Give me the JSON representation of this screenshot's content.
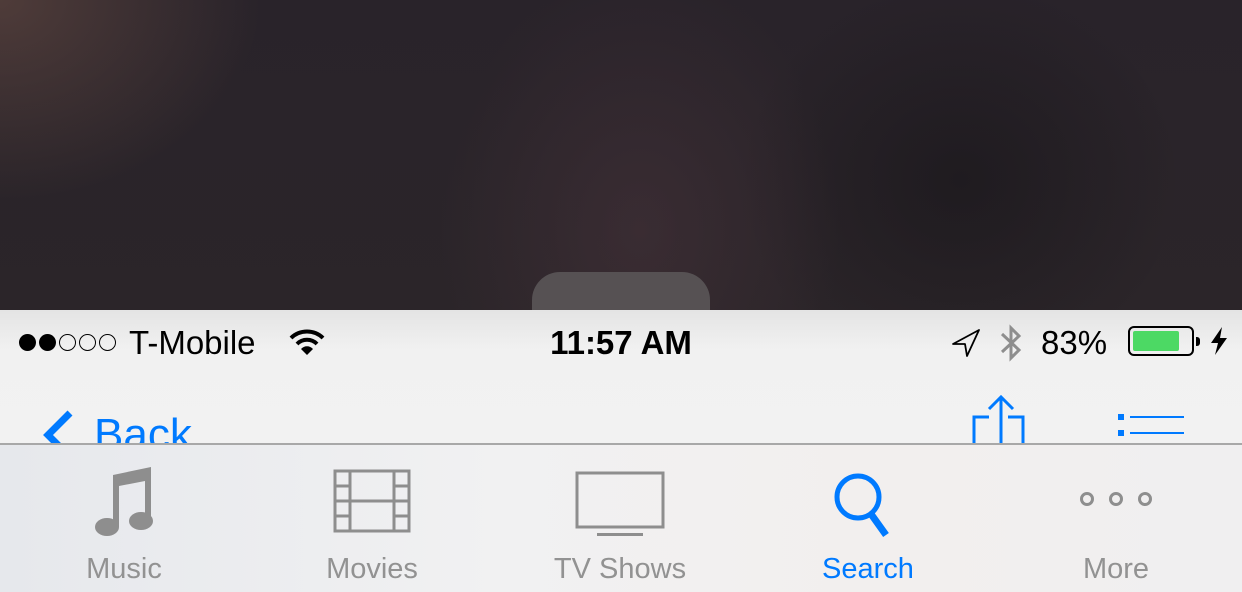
{
  "status_bar": {
    "signal_bars_filled": 2,
    "signal_bars_total": 5,
    "carrier": "T-Mobile",
    "wifi_icon": "wifi-icon",
    "time": "11:57 AM",
    "location_icon": "location-arrow-icon",
    "bluetooth_icon": "bluetooth-icon",
    "battery_percent_label": "83%",
    "battery_level": 0.83,
    "charging_icon": "charging-bolt-icon",
    "battery_color": "#4cd964"
  },
  "nav_bar": {
    "back_label": "Back",
    "back_icon": "chevron-left-icon",
    "share_icon": "share-icon",
    "list_icon": "list-icon",
    "accent_color": "#007aff"
  },
  "tab_bar": {
    "active_index": 3,
    "active_color": "#007aff",
    "inactive_color": "#929292",
    "tabs": [
      {
        "label": "Music",
        "icon": "music-note-icon"
      },
      {
        "label": "Movies",
        "icon": "film-strip-icon"
      },
      {
        "label": "TV Shows",
        "icon": "tv-icon"
      },
      {
        "label": "Search",
        "icon": "search-icon"
      },
      {
        "label": "More",
        "icon": "more-dots-icon"
      }
    ]
  }
}
